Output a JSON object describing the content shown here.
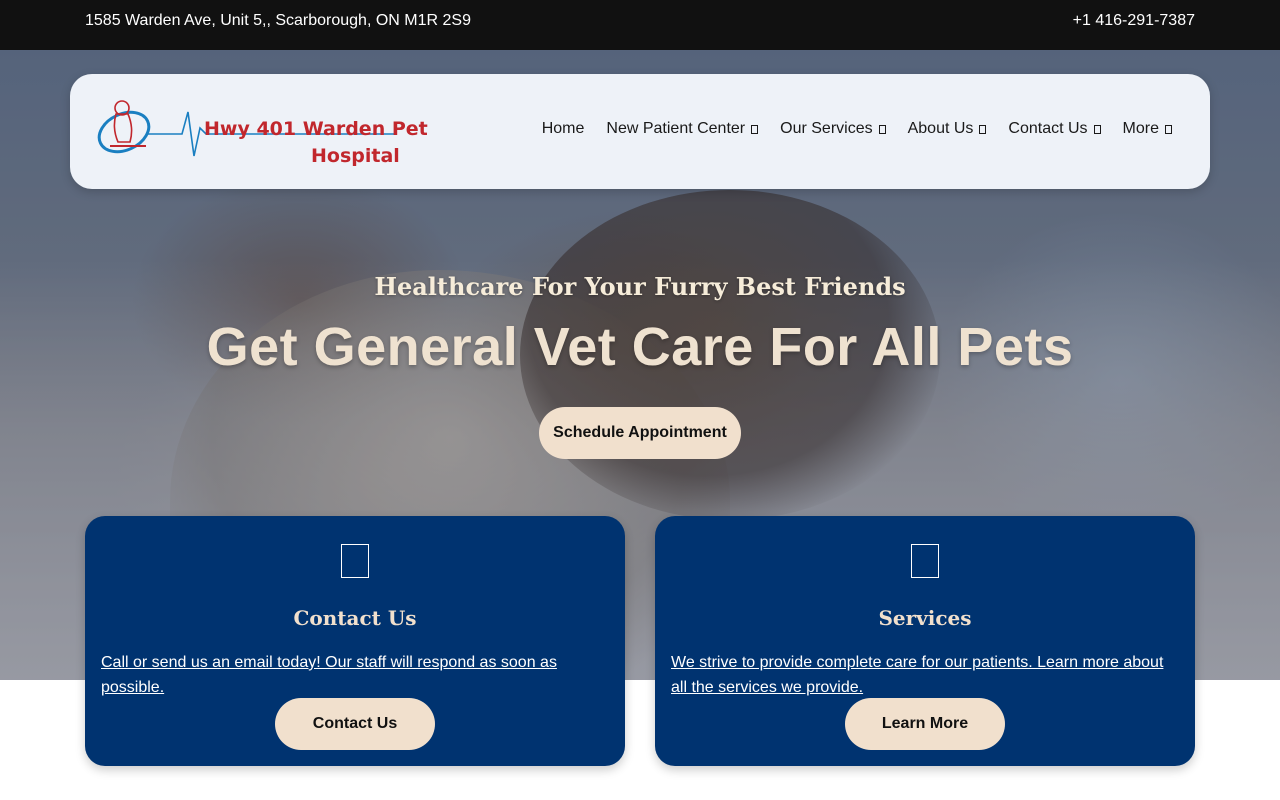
{
  "topbar": {
    "address": "1585 Warden Ave, Unit 5,, Scarborough, ON M1R 2S9",
    "phone": "+1 416-291-7387"
  },
  "logo": {
    "line1": "Hwy 401 Warden Pet",
    "line2": "Hospital",
    "icon": "dog-pulse-logo"
  },
  "nav": {
    "items": [
      {
        "label": "Home",
        "dropdown": false
      },
      {
        "label": "New Patient Center",
        "dropdown": true
      },
      {
        "label": "Our Services",
        "dropdown": true
      },
      {
        "label": "About Us",
        "dropdown": true
      },
      {
        "label": "Contact Us",
        "dropdown": true
      },
      {
        "label": "More",
        "dropdown": true
      }
    ]
  },
  "hero": {
    "tagline": "Healthcare For Your Furry Best Friends",
    "headline": "Get General Vet Care For All Pets",
    "cta_label": "Schedule Appointment"
  },
  "cards": [
    {
      "icon": "phone-icon",
      "title": "Contact Us",
      "description": "Call or send us an email today! Our staff will respond as soon as possible.",
      "button_label": "Contact Us"
    },
    {
      "icon": "paw-icon",
      "title": "Services",
      "description": "We strive to provide complete care for our patients. Learn more about all the services we provide.",
      "button_label": "Learn More"
    }
  ],
  "colors": {
    "topbar_bg": "#111111",
    "card_bg": "#003370",
    "cream": "#f1e0cd",
    "logo_red": "#c1272d",
    "logo_blue": "#1a7fc1"
  }
}
